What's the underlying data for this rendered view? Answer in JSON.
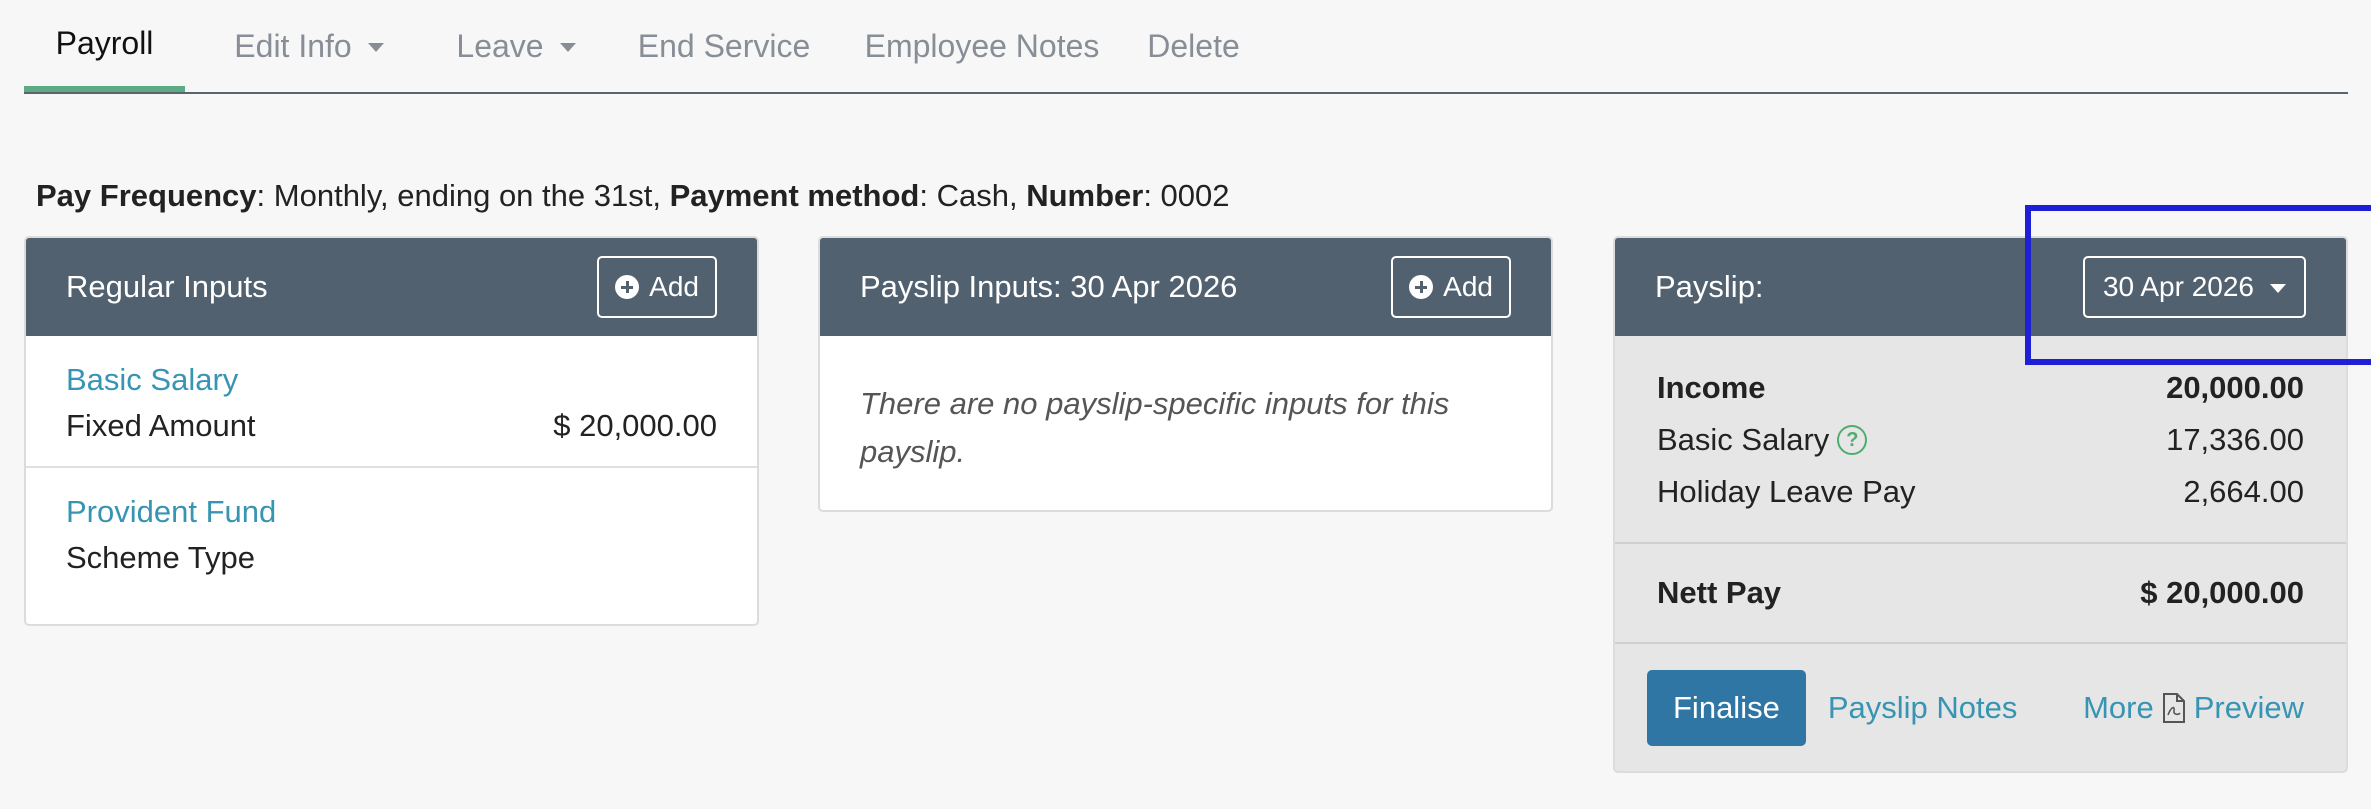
{
  "tabs": [
    {
      "label": "Payroll",
      "active": true
    },
    {
      "label": "Edit Info",
      "dropdown": true
    },
    {
      "label": "Leave",
      "dropdown": true
    },
    {
      "label": "End Service"
    },
    {
      "label": "Employee Notes"
    },
    {
      "label": "Delete"
    }
  ],
  "info": {
    "freq_label": "Pay Frequency",
    "freq_value": ": Monthly, ending on the 31st, ",
    "method_label": "Payment method",
    "method_value": ": Cash, ",
    "number_label": "Number",
    "number_value": ": 0002"
  },
  "regular_inputs": {
    "title": "Regular Inputs",
    "add_label": "Add",
    "items": [
      {
        "name": "Basic Salary",
        "detail_label": "Fixed Amount",
        "detail_value": "$ 20,000.00"
      },
      {
        "name": "Provident Fund",
        "detail_label": "Scheme Type",
        "detail_value": ""
      }
    ]
  },
  "payslip_inputs": {
    "title": "Payslip Inputs: 30 Apr 2026",
    "add_label": "Add",
    "empty_message": "There are no payslip-specific inputs for this payslip."
  },
  "payslip": {
    "title": "Payslip:",
    "date_selected": "30 Apr 2026",
    "income_label": "Income",
    "income_total": "20,000.00",
    "lines": [
      {
        "label": "Basic Salary",
        "value": "17,336.00",
        "help": true
      },
      {
        "label": "Holiday Leave Pay",
        "value": "2,664.00"
      }
    ],
    "nett_label": "Nett Pay",
    "nett_value": "$ 20,000.00",
    "actions": {
      "finalise": "Finalise",
      "notes": "Payslip Notes",
      "more": "More",
      "preview": "Preview"
    }
  },
  "colors": {
    "header_bg": "#526170",
    "link": "#3794b3",
    "primary": "#2f76a5",
    "active_tab_underline": "#5dab85",
    "highlight": "#1f1fd6"
  },
  "icons": {
    "add": "plus-circle-icon",
    "help": "question-circle-icon",
    "preview": "pdf-file-icon",
    "dropdown": "caret-down-icon"
  }
}
